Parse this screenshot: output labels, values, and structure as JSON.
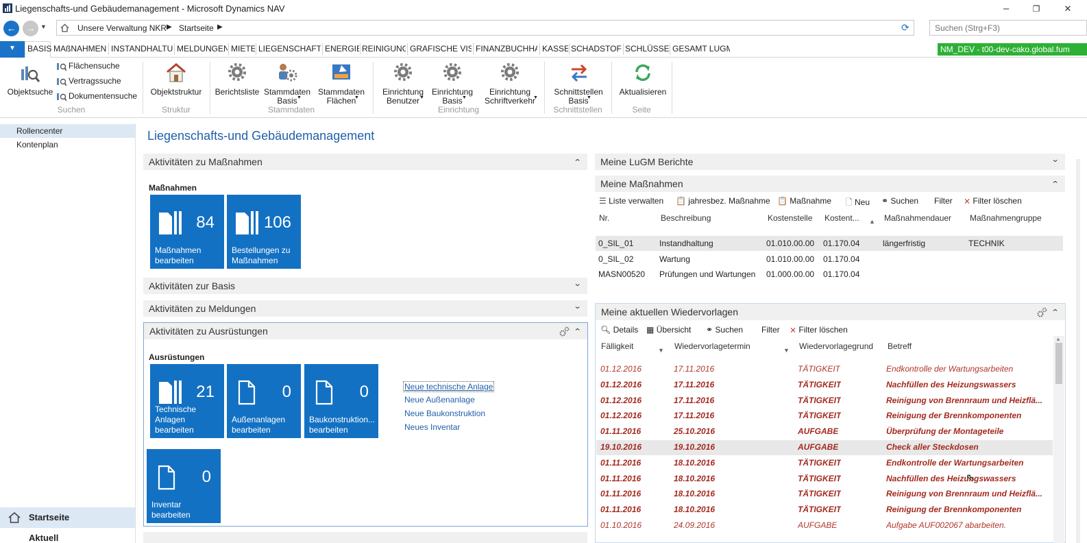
{
  "window": {
    "title": "Liegenschafts-und Gebäudemanagement - Microsoft Dynamics NAV",
    "minimize": "–",
    "maximize": "❐",
    "close": "✕"
  },
  "address": {
    "crumb1": "Unsere Verwaltung NKR",
    "crumb2": "Startseite",
    "search_placeholder": "Suchen (Strg+F3)"
  },
  "tabs": [
    "BASIS",
    "MAßNAHMEN",
    "INSTANDHALTUN",
    "MELDUNGEN",
    "MIETE",
    "LIEGENSCHAFTSI",
    "ENERGIE",
    "REINIGUNG",
    "GRAFISCHE VISU",
    "FINANZBUCHHA",
    "KASSE",
    "SCHADSTOFF",
    "SCHLÜSSEL",
    "GESAMT LUGM"
  ],
  "env_badge": "NM_DEV - t00-dev-cako.global.fum",
  "ribbon": {
    "objektsuche": "Objektsuche",
    "flaechensuche": "Flächensuche",
    "vertragssuche": "Vertragssuche",
    "dokumentensuche": "Dokumentensuche",
    "grp_suchen": "Suchen",
    "objektstruktur": "Objektstruktur",
    "grp_struktur": "Struktur",
    "berichtsliste": "Berichtsliste",
    "stamm_basis_1": "Stammdaten",
    "stamm_basis_2": "Basis",
    "stamm_fl_1": "Stammdaten",
    "stamm_fl_2": "Flächen",
    "grp_stammdaten": "Stammdaten",
    "einr_ben_1": "Einrichtung",
    "einr_ben_2": "Benutzer",
    "einr_bas_1": "Einrichtung",
    "einr_bas_2": "Basis",
    "einr_sch_1": "Einrichtung",
    "einr_sch_2": "Schriftverkehr",
    "grp_einrichtung": "Einrichtung",
    "schn_1": "Schnittstellen",
    "schn_2": "Basis",
    "grp_schnittstellen": "Schnittstellen",
    "aktualisieren": "Aktualisieren",
    "grp_seite": "Seite"
  },
  "nav": {
    "rollencenter": "Rollencenter",
    "kontenplan": "Kontenplan",
    "startseite": "Startseite",
    "aktuell": "Aktuell"
  },
  "page_title": "Liegenschafts-und Gebäudemanagement",
  "left": {
    "sec1": "Aktivitäten zu Maßnahmen",
    "sec1_sub": "Maßnahmen",
    "tile1_num": "84",
    "tile1_lbl": "Maßnahmen bearbeiten",
    "tile2_num": "106",
    "tile2_lbl": "Bestellungen zu Maßnahmen",
    "sec2": "Aktivitäten zur Basis",
    "sec3": "Aktivitäten zu Meldungen",
    "sec4": "Aktivitäten zu Ausrüstungen",
    "sec4_sub": "Ausrüstungen",
    "t3_num": "21",
    "t3_lbl": "Technische Anlagen bearbeiten",
    "t4_num": "0",
    "t4_lbl": "Außenanlagen bearbeiten",
    "t5_num": "0",
    "t5_lbl": "Baukonstruktion... bearbeiten",
    "t6_num": "0",
    "t6_lbl": "Inventar bearbeiten",
    "link1": "Neue technische Anlage",
    "link2": "Neue Außenanlage",
    "link3": "Neue Baukonstruktion",
    "link4": "Neues Inventar"
  },
  "right": {
    "sec1": "Meine LuGM Berichte",
    "sec2": "Meine Maßnahmen",
    "tb": {
      "liste": "Liste verwalten",
      "jahres": "jahresbez. Maßnahme",
      "massnahme": "Maßnahme",
      "neu": "Neu",
      "suchen": "Suchen",
      "filter": "Filter",
      "filterdel": "Filter löschen"
    },
    "cols": [
      "Nr.",
      "Beschreibung",
      "Kostenstelle",
      "Kostent...",
      "Maßnahmendauer",
      "Maßnahmengruppe"
    ],
    "rows": [
      [
        "0_SIL_01",
        "Instandhaltung",
        "01.010.00.00",
        "01.170.04",
        "längerfristig",
        "TECHNIK"
      ],
      [
        "0_SIL_02",
        "Wartung",
        "01.010.00.00",
        "01.170.04",
        "",
        ""
      ],
      [
        "MASN00520",
        "Prüfungen und Wartungen",
        "01.000.00.00",
        "01.170.04",
        "",
        ""
      ]
    ],
    "sec3": "Meine aktuellen Wiedervorlagen",
    "tb2": {
      "details": "Details",
      "uebersicht": "Übersicht",
      "suchen": "Suchen",
      "filter": "Filter",
      "filterdel": "Filter löschen"
    },
    "cols2": [
      "Fälligkeit",
      "Wiedervorlagetermin",
      "Wiedervorlagegrund",
      "Betreff"
    ],
    "rows2": [
      [
        "01.12.2016",
        "17.11.2016",
        "TÄTIGKEIT",
        "Endkontrolle der Wartungsarbeiten"
      ],
      [
        "01.12.2016",
        "17.11.2016",
        "TÄTIGKEIT",
        "Nachfüllen des Heizungswassers"
      ],
      [
        "01.12.2016",
        "17.11.2016",
        "TÄTIGKEIT",
        "Reinigung von Brennraum und Heizflä..."
      ],
      [
        "01.12.2016",
        "17.11.2016",
        "TÄTIGKEIT",
        "Reinigung der Brennkomponenten"
      ],
      [
        "01.11.2016",
        "25.10.2016",
        "AUFGABE",
        "Überprüfung der Montageteile"
      ],
      [
        "19.10.2016",
        "19.10.2016",
        "AUFGABE",
        "Check aller Steckdosen"
      ],
      [
        "01.11.2016",
        "18.10.2016",
        "TÄTIGKEIT",
        "Endkontrolle der Wartungsarbeiten"
      ],
      [
        "01.11.2016",
        "18.10.2016",
        "TÄTIGKEIT",
        "Nachfüllen des Heizungswassers"
      ],
      [
        "01.11.2016",
        "18.10.2016",
        "TÄTIGKEIT",
        "Reinigung von Brennraum und Heizflä..."
      ],
      [
        "01.11.2016",
        "18.10.2016",
        "TÄTIGKEIT",
        "Reinigung der Brennkomponenten"
      ],
      [
        "01.10.2016",
        "24.09.2016",
        "AUFGABE",
        "Aufgabe AUF002067 abarbeiten."
      ]
    ]
  }
}
